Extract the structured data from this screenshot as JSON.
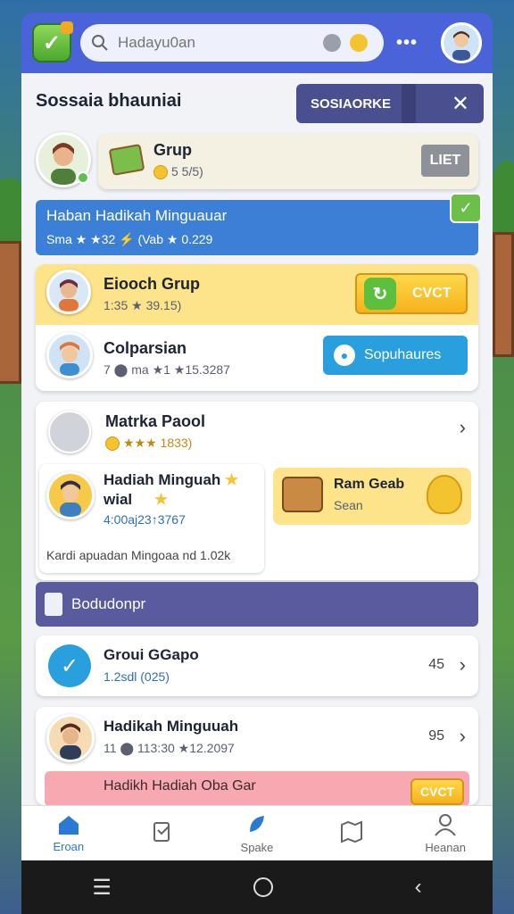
{
  "search": {
    "placeholder": "Hadayu0an"
  },
  "more_dots": "•••",
  "header": {
    "title": "Sossaia bhauniai",
    "button_label": "SOSIAORKE"
  },
  "grup_card": {
    "title": "Grup",
    "sub": "5 5/5)",
    "button": "LIET"
  },
  "banner_weekly": {
    "title": "Haban Hadikah Minguauar",
    "stats": "Sma ★ ★32 ⚡ (Vab ★ 0.229"
  },
  "friend_card": {
    "row1": {
      "title": "Eiooch Grup",
      "sub": "1:35 ★ 39.15)",
      "button": "CVCT"
    },
    "row2": {
      "title": "Colparsian",
      "sub": "7 ⬤ ma ★1 ★15.3287",
      "button": "Sopuhaures"
    }
  },
  "matrix_card": {
    "title": "Matrka Paool",
    "sub": "★★★ 1833)"
  },
  "hadiah_card": {
    "title": "Hadiah Minguah",
    "title2": "wial",
    "sub": "4:00aj23↑3767",
    "footer": "Kardi apuadan Mingoaa nd 1.02k"
  },
  "reward_card": {
    "title": "Ram Geab",
    "sub": "Sean"
  },
  "section_banner": {
    "title": "Bodudonpr"
  },
  "group_card2": {
    "title": "Groui GGapo",
    "sub": "1.2sdl (025)",
    "count": "45"
  },
  "hadiah_card2": {
    "title": "Hadikah Minguuah",
    "sub": "11 ⬤ 113:30 ★12.2097",
    "count": "95"
  },
  "pink_banner": {
    "title": "Hadikh Hadiah Oba Gar",
    "button": "CVCT"
  },
  "nav": [
    {
      "label": "Eroan"
    },
    {
      "label": ""
    },
    {
      "label": "Spake"
    },
    {
      "label": ""
    },
    {
      "label": "Heanan"
    }
  ],
  "colors": {
    "primary": "#4a63d8",
    "accent_green": "#5cc24a",
    "gold": "#f4c430",
    "blue_button": "#2a9fde",
    "section": "#5a5a9e"
  }
}
